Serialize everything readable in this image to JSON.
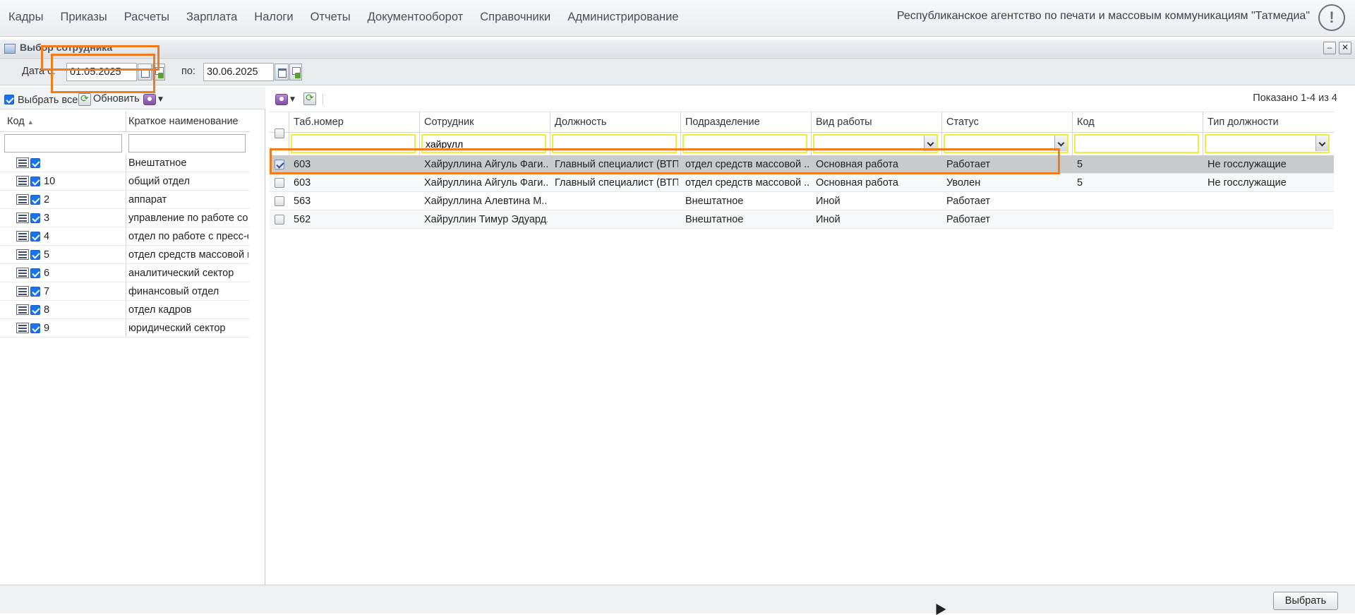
{
  "menu": {
    "items": [
      "Кадры",
      "Приказы",
      "Расчеты",
      "Зарплата",
      "Налоги",
      "Отчеты",
      "Документооборот",
      "Справочники",
      "Администрирование"
    ],
    "organization": "Республиканское агентство по печати и массовым коммуникациям \"Татмедиа\"",
    "alert_glyph": "!"
  },
  "window": {
    "title": "Выбор сотрудника",
    "minimize_glyph": "–",
    "close_glyph": "✕"
  },
  "date_filter": {
    "from_label": "Дата с:",
    "from_value": "01.05.2025",
    "to_label": "по:",
    "to_value": "30.06.2025"
  },
  "left_panel": {
    "select_all_label": "Выбрать все",
    "refresh_label": "Обновить",
    "columns": [
      "Код",
      "Краткое наименование"
    ],
    "sort_indicator": "▲",
    "rows": [
      {
        "code": "",
        "name": "Внештатное"
      },
      {
        "code": "10",
        "name": "общий отдел"
      },
      {
        "code": "2",
        "name": "аппарат"
      },
      {
        "code": "3",
        "name": "управление по работе со с"
      },
      {
        "code": "4",
        "name": "отдел по работе с пресс-сл"
      },
      {
        "code": "5",
        "name": "отдел средств массовой ин"
      },
      {
        "code": "6",
        "name": "аналитический сектор"
      },
      {
        "code": "7",
        "name": "финансовый отдел"
      },
      {
        "code": "8",
        "name": "отдел кадров"
      },
      {
        "code": "9",
        "name": "юридический сектор"
      }
    ]
  },
  "grid": {
    "shown_text": "Показано 1-4 из 4",
    "columns": [
      "Таб.номер",
      "Сотрудник",
      "Должность",
      "Подразделение",
      "Вид работы",
      "Статус",
      "Код",
      "Тип должности"
    ],
    "filters": [
      "",
      "хайрулл",
      "",
      "",
      "",
      "",
      "",
      ""
    ],
    "rows": [
      {
        "tab": "603",
        "employee": "Хайруллина Айгуль Фаги...",
        "position": "Главный специалист (ВТП)",
        "department": "отдел средств массовой ...",
        "work_type": "Основная работа",
        "status": "Работает",
        "code": "5",
        "position_type": "Не госслужащие",
        "selected": true
      },
      {
        "tab": "603",
        "employee": "Хайруллина Айгуль Фаги...",
        "position": "Главный специалист (ВТП)",
        "department": "отдел средств массовой ...",
        "work_type": "Основная работа",
        "status": "Уволен",
        "code": "5",
        "position_type": "Не госслужащие",
        "selected": false
      },
      {
        "tab": "563",
        "employee": "Хайруллина Алевтина М...",
        "position": "",
        "department": "Внештатное",
        "work_type": "Иной",
        "status": "Работает",
        "code": "",
        "position_type": "",
        "selected": false
      },
      {
        "tab": "562",
        "employee": "Хайруллин Тимур Эдуард...",
        "position": "",
        "department": "Внештатное",
        "work_type": "Иной",
        "status": "Работает",
        "code": "",
        "position_type": "",
        "selected": false
      }
    ]
  },
  "footer": {
    "select_button": "Выбрать"
  },
  "colors": {
    "annotation": "#f07c1e",
    "filter_highlight": "#f1ee3a",
    "checkbox_blue": "#1a73e8"
  }
}
